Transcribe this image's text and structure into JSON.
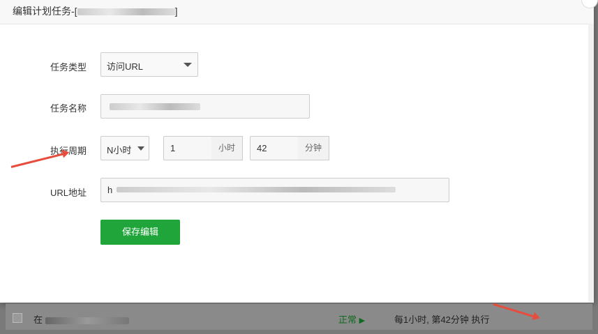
{
  "modal": {
    "title_prefix": "编辑计划任务-[",
    "title_suffix": "]"
  },
  "form": {
    "task_type_label": "任务类型",
    "task_type_value": "访问URL",
    "task_name_label": "任务名称",
    "cycle_label": "执行周期",
    "cycle_type_value": "N小时",
    "hour_value": "1",
    "hour_unit": "小时",
    "minute_value": "42",
    "minute_unit": "分钟",
    "url_label": "URL地址",
    "url_value_prefix": "h",
    "save_label": "保存编辑"
  },
  "bottom_row": {
    "name_prefix": "在",
    "status": "正常",
    "cycle_text": "每1小时, 第42分钟 执行"
  },
  "colors": {
    "primary_green": "#20a53a",
    "arrow_red": "#e84c3d"
  },
  "icons": [
    "close-icon",
    "chevron-down-icon",
    "play-triangle-icon"
  ]
}
